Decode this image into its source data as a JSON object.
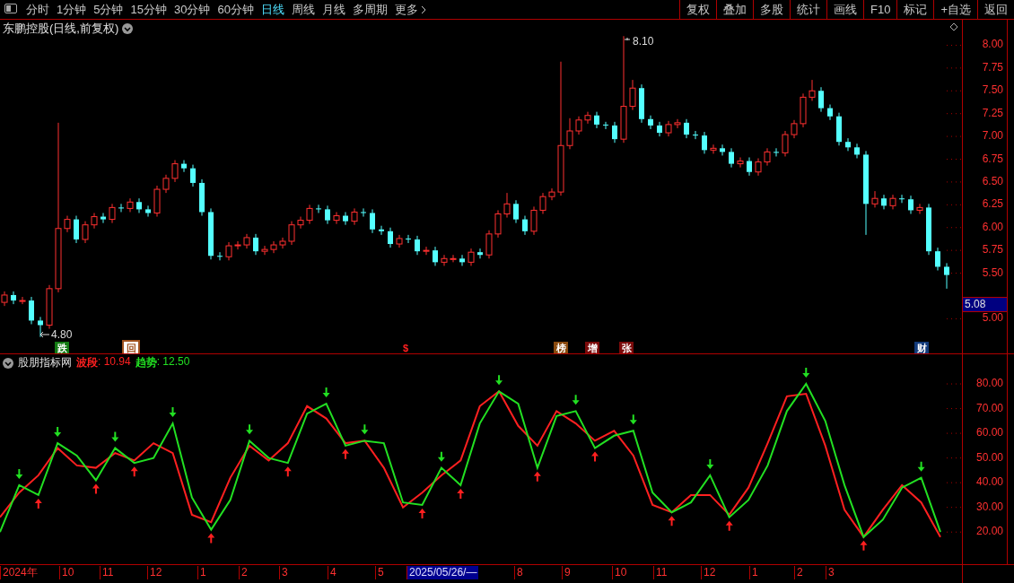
{
  "toolbar": {
    "periods": [
      {
        "label": "分时",
        "selected": false
      },
      {
        "label": "1分钟",
        "selected": false
      },
      {
        "label": "5分钟",
        "selected": false
      },
      {
        "label": "15分钟",
        "selected": false
      },
      {
        "label": "30分钟",
        "selected": false
      },
      {
        "label": "60分钟",
        "selected": false
      },
      {
        "label": "日线",
        "selected": true
      },
      {
        "label": "周线",
        "selected": false
      },
      {
        "label": "月线",
        "selected": false
      },
      {
        "label": "多周期",
        "selected": false
      }
    ],
    "more": "更多",
    "actions": [
      "复权",
      "叠加",
      "多股",
      "统计",
      "画线",
      "F10",
      "标记",
      "+自选",
      "返回"
    ]
  },
  "chart": {
    "title": "东鹏控股(日线,前复权)",
    "high_label": "8.10",
    "low_label": "4.80",
    "current_price": "5.08",
    "markers": [
      {
        "label": "跌",
        "kind": "filled",
        "color": "#137a13"
      },
      {
        "label": "回",
        "kind": "outline",
        "color": "#a0521e"
      },
      {
        "label": "$",
        "kind": "plain",
        "color": "#ff2020"
      },
      {
        "label": "榜",
        "kind": "filled",
        "color": "#8a4a0e"
      },
      {
        "label": "增",
        "kind": "filled",
        "color": "#7a0a0a"
      },
      {
        "label": "张",
        "kind": "filled",
        "color": "#7a0a0a"
      },
      {
        "label": "财",
        "kind": "filled",
        "color": "#123a7a"
      }
    ],
    "chart_data": {
      "type": "candlestick",
      "ylim": [
        4.62,
        8.28
      ],
      "yticks": [
        {
          "value": 8,
          "label": "8.00"
        },
        {
          "value": 7.75,
          "label": "7.75"
        },
        {
          "value": 7.5,
          "label": "7.50"
        },
        {
          "value": 7.25,
          "label": "7.25"
        },
        {
          "value": 7,
          "label": "7.00"
        },
        {
          "value": 6.75,
          "label": "6.75"
        },
        {
          "value": 6.5,
          "label": "6.50"
        },
        {
          "value": 6.25,
          "label": "6.25"
        },
        {
          "value": 6,
          "label": "6.00"
        },
        {
          "value": 5.75,
          "label": "5.75"
        },
        {
          "value": 5.5,
          "label": "5.50"
        },
        {
          "value": 5,
          "label": "5.00"
        }
      ],
      "ohlc": [
        [
          5.18,
          5.3,
          5.14,
          5.26
        ],
        [
          5.26,
          5.3,
          5.16,
          5.2
        ],
        [
          5.2,
          5.24,
          5.16,
          5.2
        ],
        [
          5.2,
          5.24,
          4.94,
          4.98
        ],
        [
          4.98,
          5.02,
          4.8,
          4.93
        ],
        [
          4.93,
          5.37,
          4.89,
          5.33
        ],
        [
          5.33,
          7.15,
          5.29,
          5.99
        ],
        [
          5.99,
          6.13,
          5.95,
          6.09
        ],
        [
          6.09,
          6.13,
          5.83,
          5.87
        ],
        [
          5.87,
          6.07,
          5.83,
          6.03
        ],
        [
          6.03,
          6.16,
          5.99,
          6.12
        ],
        [
          6.12,
          6.16,
          6.05,
          6.09
        ],
        [
          6.09,
          6.26,
          6.05,
          6.22
        ],
        [
          6.22,
          6.26,
          6.17,
          6.21
        ],
        [
          6.21,
          6.32,
          6.17,
          6.28
        ],
        [
          6.28,
          6.32,
          6.16,
          6.2
        ],
        [
          6.2,
          6.24,
          6.12,
          6.16
        ],
        [
          6.16,
          6.46,
          6.12,
          6.42
        ],
        [
          6.42,
          6.58,
          6.38,
          6.54
        ],
        [
          6.54,
          6.74,
          6.5,
          6.7
        ],
        [
          6.7,
          6.74,
          6.61,
          6.65
        ],
        [
          6.65,
          6.69,
          6.45,
          6.49
        ],
        [
          6.49,
          6.53,
          6.13,
          6.17
        ],
        [
          6.17,
          6.21,
          5.65,
          5.69
        ],
        [
          5.69,
          5.73,
          5.64,
          5.68
        ],
        [
          5.68,
          5.84,
          5.64,
          5.8
        ],
        [
          5.8,
          5.85,
          5.76,
          5.81
        ],
        [
          5.81,
          5.93,
          5.77,
          5.89
        ],
        [
          5.89,
          5.93,
          5.7,
          5.74
        ],
        [
          5.74,
          5.8,
          5.7,
          5.76
        ],
        [
          5.76,
          5.85,
          5.72,
          5.81
        ],
        [
          5.81,
          5.89,
          5.77,
          5.85
        ],
        [
          5.85,
          6.07,
          5.81,
          6.03
        ],
        [
          6.03,
          6.12,
          5.99,
          6.08
        ],
        [
          6.08,
          6.25,
          6.04,
          6.21
        ],
        [
          6.21,
          6.25,
          6.16,
          6.2
        ],
        [
          6.2,
          6.24,
          6.04,
          6.08
        ],
        [
          6.08,
          6.17,
          6.04,
          6.13
        ],
        [
          6.13,
          6.17,
          6.03,
          6.07
        ],
        [
          6.07,
          6.21,
          6.03,
          6.17
        ],
        [
          6.17,
          6.21,
          6.12,
          6.16
        ],
        [
          6.16,
          6.2,
          5.94,
          5.98
        ],
        [
          5.98,
          6.02,
          5.92,
          5.96
        ],
        [
          5.96,
          6.0,
          5.78,
          5.82
        ],
        [
          5.82,
          5.92,
          5.78,
          5.88
        ],
        [
          5.88,
          5.92,
          5.83,
          5.87
        ],
        [
          5.87,
          5.91,
          5.7,
          5.74
        ],
        [
          5.74,
          5.79,
          5.7,
          5.75
        ],
        [
          5.75,
          5.79,
          5.58,
          5.62
        ],
        [
          5.62,
          5.7,
          5.58,
          5.66
        ],
        [
          5.66,
          5.7,
          5.62,
          5.66
        ],
        [
          5.66,
          5.7,
          5.58,
          5.62
        ],
        [
          5.62,
          5.77,
          5.58,
          5.73
        ],
        [
          5.73,
          5.77,
          5.66,
          5.7
        ],
        [
          5.7,
          5.97,
          5.66,
          5.93
        ],
        [
          5.93,
          6.19,
          5.89,
          6.15
        ],
        [
          6.15,
          6.38,
          6.11,
          6.26
        ],
        [
          6.26,
          6.3,
          6.05,
          6.09
        ],
        [
          6.09,
          6.13,
          5.92,
          5.96
        ],
        [
          5.96,
          6.23,
          5.92,
          6.19
        ],
        [
          6.19,
          6.38,
          6.15,
          6.34
        ],
        [
          6.34,
          6.43,
          6.3,
          6.39
        ],
        [
          6.39,
          7.82,
          6.35,
          6.9
        ],
        [
          6.9,
          7.2,
          6.86,
          7.06
        ],
        [
          7.06,
          7.22,
          7.02,
          7.18
        ],
        [
          7.18,
          7.27,
          7.14,
          7.23
        ],
        [
          7.23,
          7.27,
          7.09,
          7.13
        ],
        [
          7.13,
          7.16,
          7.08,
          7.12
        ],
        [
          7.12,
          7.16,
          6.93,
          6.97
        ],
        [
          6.97,
          8.1,
          6.93,
          7.33
        ],
        [
          7.33,
          7.62,
          7.29,
          7.53
        ],
        [
          7.53,
          7.57,
          7.15,
          7.19
        ],
        [
          7.19,
          7.23,
          7.08,
          7.12
        ],
        [
          7.12,
          7.16,
          7.0,
          7.04
        ],
        [
          7.04,
          7.17,
          7.0,
          7.13
        ],
        [
          7.13,
          7.19,
          7.09,
          7.15
        ],
        [
          7.15,
          7.19,
          6.98,
          7.02
        ],
        [
          7.02,
          7.06,
          6.97,
          7.01
        ],
        [
          7.01,
          7.05,
          6.81,
          6.85
        ],
        [
          6.85,
          6.91,
          6.81,
          6.87
        ],
        [
          6.87,
          6.91,
          6.79,
          6.83
        ],
        [
          6.83,
          6.87,
          6.66,
          6.7
        ],
        [
          6.7,
          6.77,
          6.66,
          6.73
        ],
        [
          6.73,
          6.77,
          6.57,
          6.61
        ],
        [
          6.61,
          6.76,
          6.57,
          6.72
        ],
        [
          6.72,
          6.87,
          6.68,
          6.83
        ],
        [
          6.83,
          6.87,
          6.78,
          6.82
        ],
        [
          6.82,
          7.06,
          6.78,
          7.02
        ],
        [
          7.02,
          7.18,
          6.98,
          7.14
        ],
        [
          7.14,
          7.47,
          7.1,
          7.43
        ],
        [
          7.43,
          7.62,
          7.39,
          7.5
        ],
        [
          7.5,
          7.54,
          7.27,
          7.31
        ],
        [
          7.31,
          7.35,
          7.18,
          7.22
        ],
        [
          7.22,
          7.26,
          6.9,
          6.94
        ],
        [
          6.94,
          6.98,
          6.84,
          6.88
        ],
        [
          6.88,
          6.92,
          6.76,
          6.8
        ],
        [
          6.8,
          6.84,
          5.92,
          6.26
        ],
        [
          6.26,
          6.4,
          6.22,
          6.32
        ],
        [
          6.32,
          6.36,
          6.2,
          6.24
        ],
        [
          6.24,
          6.36,
          6.2,
          6.32
        ],
        [
          6.32,
          6.36,
          6.27,
          6.31
        ],
        [
          6.31,
          6.35,
          6.15,
          6.19
        ],
        [
          6.19,
          6.26,
          6.15,
          6.22
        ],
        [
          6.22,
          6.26,
          5.7,
          5.74
        ],
        [
          5.74,
          5.78,
          5.53,
          5.57
        ],
        [
          5.57,
          5.61,
          5.33,
          5.48
        ]
      ]
    }
  },
  "indicator": {
    "name": "股朋指标网",
    "values": [
      ": 10.94",
      ": 12.50"
    ],
    "chart_data": {
      "type": "line",
      "ylim": [
        7,
        92
      ],
      "yticks": [
        {
          "value": 80,
          "label": "80.00"
        },
        {
          "value": 70,
          "label": "70.00"
        },
        {
          "value": 60,
          "label": "60.00"
        },
        {
          "value": 50,
          "label": "50.00"
        },
        {
          "value": 40,
          "label": "40.00"
        },
        {
          "value": 30,
          "label": "30.00"
        },
        {
          "value": 20,
          "label": "20.00"
        }
      ],
      "series": [
        {
          "name": "波段",
          "color": "#ff2020",
          "values": [
            26,
            36,
            43,
            54,
            47,
            46,
            52,
            49,
            56,
            52,
            27,
            24,
            42,
            55,
            49,
            56,
            71,
            66,
            56,
            57,
            46,
            30,
            36,
            43,
            49,
            71,
            77,
            63,
            55,
            69,
            64,
            57,
            61,
            51,
            31,
            28,
            35,
            35,
            27,
            38,
            56,
            75,
            76,
            55,
            29,
            18,
            29,
            39,
            32,
            18
          ]
        },
        {
          "name": "趋势",
          "color": "#22e022",
          "values": [
            20,
            39,
            35,
            56,
            51,
            41,
            54,
            48,
            50,
            64,
            34,
            21,
            33,
            57,
            50,
            48,
            68,
            72,
            55,
            57,
            56,
            32,
            31,
            46,
            39,
            64,
            77,
            72,
            46,
            67,
            69,
            54,
            59,
            61,
            36,
            28,
            32,
            43,
            26,
            33,
            47,
            69,
            80,
            65,
            39,
            18,
            25,
            38,
            42,
            20
          ]
        }
      ]
    }
  },
  "date_axis": [
    {
      "label": "2024年",
      "selected": false
    },
    {
      "label": "10",
      "selected": false
    },
    {
      "label": "11",
      "selected": false
    },
    {
      "label": "12",
      "selected": false
    },
    {
      "label": "1",
      "selected": false
    },
    {
      "label": "2",
      "selected": false
    },
    {
      "label": "3",
      "selected": false
    },
    {
      "label": "4",
      "selected": false
    },
    {
      "label": "5",
      "selected": false
    },
    {
      "label": "2025/05/26/—",
      "selected": true
    },
    {
      "label": "8",
      "selected": false
    },
    {
      "label": "9",
      "selected": false
    },
    {
      "label": "10",
      "selected": false
    },
    {
      "label": "11",
      "selected": false
    },
    {
      "label": "12",
      "selected": false
    },
    {
      "label": "1",
      "selected": false
    },
    {
      "label": "2",
      "selected": false
    },
    {
      "label": "3",
      "selected": false
    }
  ]
}
